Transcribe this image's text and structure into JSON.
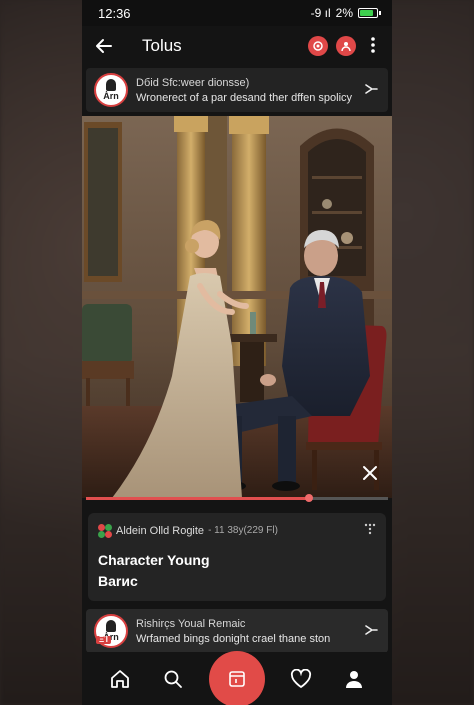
{
  "status_bar": {
    "time": "12:36",
    "signal": "-9 ıl",
    "battery_text": "2%",
    "battery_level": 0.8
  },
  "header": {
    "title": "Tolus"
  },
  "top_card": {
    "title": "Dбid Sfc:weer dionsse)",
    "subtitle": "Wronerect of a par desand ther dffen spolicy",
    "avatar_label": "Ȧrn"
  },
  "media": {
    "progress": 0.74
  },
  "info_card": {
    "author": "Aldein Olld Rogite",
    "meta": "- 11 38у(229 Fl)",
    "title": "Character Young",
    "subtitle": "Barиc"
  },
  "bottom_card": {
    "title": "Rishirc̦s Youal Remaic",
    "subtitle": "Wrfamed bings donight crael thane ston",
    "avatar_label": "Ȧrn",
    "badge": "ΞΊ"
  },
  "colors": {
    "accent": "#e14b48",
    "background": "#141414",
    "card": "#242424"
  },
  "nav": {
    "items": [
      "home-icon",
      "search-icon",
      "create-icon",
      "heart-icon",
      "profile-icon"
    ]
  }
}
